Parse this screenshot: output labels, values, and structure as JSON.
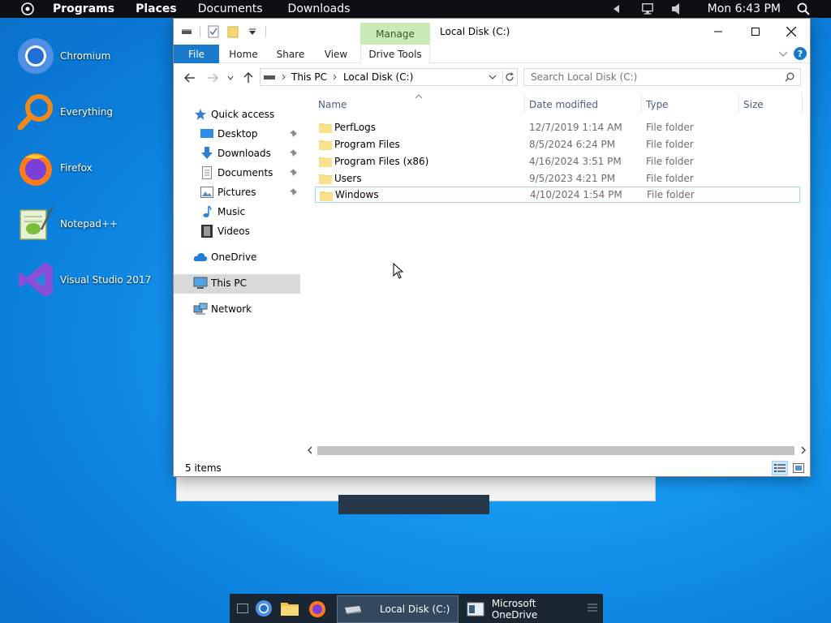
{
  "top_panel": {
    "menu_items": [
      "Programs",
      "Places",
      "Documents",
      "Downloads"
    ],
    "clock": "Mon 6:43 PM",
    "icons": [
      "system-menu-icon",
      "tray-arrow-icon",
      "network-icon",
      "volume-icon",
      "search-icon"
    ]
  },
  "desktop": {
    "icons": [
      {
        "label": "Chromium",
        "icon": "chromium-icon"
      },
      {
        "label": "Everything",
        "icon": "everything-icon"
      },
      {
        "label": "Firefox",
        "icon": "firefox-icon"
      },
      {
        "label": "Notepad++",
        "icon": "notepadpp-icon"
      },
      {
        "label": "Visual Studio 2017",
        "icon": "visual-studio-icon"
      }
    ]
  },
  "explorer": {
    "title": "Local Disk (C:)",
    "context_tab": "Manage",
    "ribbon_tabs": [
      "File",
      "Home",
      "Share",
      "View",
      "Drive Tools"
    ],
    "breadcrumb": [
      "This PC",
      "Local Disk (C:)"
    ],
    "search_placeholder": "Search Local Disk (C:)",
    "nav": {
      "quick_access": "Quick access",
      "quick_items": [
        "Desktop",
        "Downloads",
        "Documents",
        "Pictures",
        "Music",
        "Videos"
      ],
      "onedrive": "OneDrive",
      "this_pc": "This PC",
      "network": "Network"
    },
    "columns": [
      "Name",
      "Date modified",
      "Type",
      "Size"
    ],
    "files": [
      {
        "name": "PerfLogs",
        "date": "12/7/2019 1:14 AM",
        "type": "File folder"
      },
      {
        "name": "Program Files",
        "date": "8/5/2024 6:24 PM",
        "type": "File folder"
      },
      {
        "name": "Program Files (x86)",
        "date": "4/16/2024 3:51 PM",
        "type": "File folder"
      },
      {
        "name": "Users",
        "date": "9/5/2023 4:21 PM",
        "type": "File folder"
      },
      {
        "name": "Windows",
        "date": "4/10/2024 1:54 PM",
        "type": "File folder"
      }
    ],
    "status": "5 items"
  },
  "taskbar": {
    "tasks": [
      {
        "label": "Local Disk (C:)",
        "active": true
      },
      {
        "label": "Microsoft OneDrive",
        "active": false
      }
    ]
  },
  "colors": {
    "accent": "#1979ca",
    "manage_tab": "#c9ecb6",
    "selection_border": "#99d1ff",
    "nav_selected": "#d9d9d9",
    "folder": "#f8d775",
    "taskbar": "#1a2733"
  }
}
